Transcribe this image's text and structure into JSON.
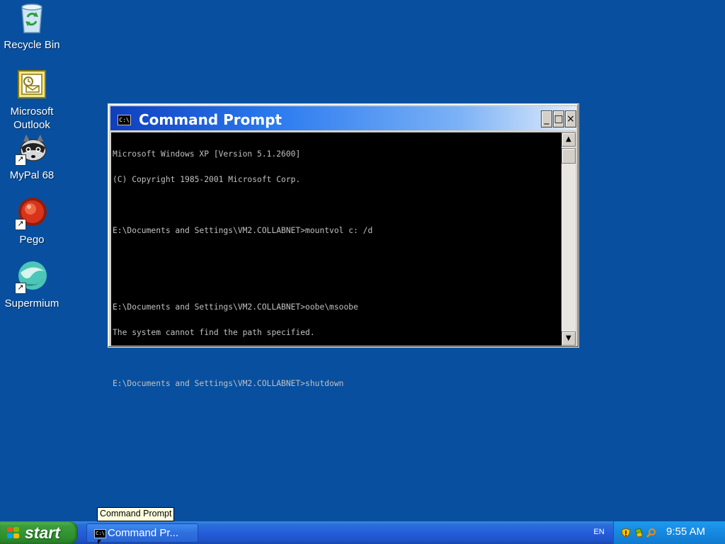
{
  "desktop": {
    "icons": [
      {
        "label": "Recycle Bin",
        "icon": "recycle-bin-icon"
      },
      {
        "label": "Microsoft Outlook",
        "icon": "outlook-icon"
      },
      {
        "label": "MyPal 68",
        "icon": "mypal-icon"
      },
      {
        "label": "Pego",
        "icon": "pego-icon"
      },
      {
        "label": "Supermium",
        "icon": "supermium-icon"
      }
    ]
  },
  "window": {
    "title": "Command Prompt",
    "icon_text": "C:\\",
    "buttons": {
      "minimize": "_",
      "maximize": "□",
      "close": "×"
    },
    "console_lines": [
      "Microsoft Windows XP [Version 5.1.2600]",
      "(C) Copyright 1985-2001 Microsoft Corp.",
      "",
      "E:\\Documents and Settings\\VM2.COLLABNET>mountvol c: /d",
      "",
      "",
      "E:\\Documents and Settings\\VM2.COLLABNET>oobe\\msoobe",
      "The system cannot find the path specified.",
      "",
      "E:\\Documents and Settings\\VM2.COLLABNET>shutdown"
    ],
    "scrollbar": {
      "up": "▲",
      "down": "▼"
    }
  },
  "tooltip": "Command Prompt",
  "taskbar": {
    "start_label": "start",
    "task_label": "Command Pr...",
    "task_icon_text": "C:\\",
    "language": "EN",
    "clock": "9:55 AM",
    "colors": {
      "taskbar": "#245edb",
      "start": "#3a9d3a",
      "tray": "#1688e0"
    }
  }
}
